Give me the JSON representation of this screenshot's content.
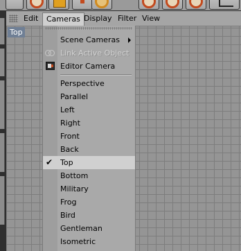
{
  "menubar": {
    "items": [
      {
        "label": "Edit"
      },
      {
        "label": "Cameras"
      },
      {
        "label": "Display"
      },
      {
        "label": "Filter"
      },
      {
        "label": "View"
      }
    ]
  },
  "viewport": {
    "view_label": "Top"
  },
  "cameras_menu": {
    "items": [
      {
        "label": "Scene Cameras",
        "has_submenu": true
      },
      {
        "label": "Link Active Object",
        "enabled": false,
        "icon": "link-icon"
      },
      {
        "label": "Editor Camera",
        "icon": "camera-icon"
      },
      {
        "label": "Perspective"
      },
      {
        "label": "Parallel"
      },
      {
        "label": "Left"
      },
      {
        "label": "Right"
      },
      {
        "label": "Front"
      },
      {
        "label": "Back"
      },
      {
        "label": "Top",
        "checked": true,
        "check_glyph": "✔"
      },
      {
        "label": "Bottom"
      },
      {
        "label": "Military"
      },
      {
        "label": "Frog"
      },
      {
        "label": "Bird"
      },
      {
        "label": "Gentleman"
      },
      {
        "label": "Isometric"
      }
    ]
  },
  "colors": {
    "viewport_bg": "#959595",
    "grid_line": "#7d7d7d",
    "menu_bg": "#a9a9a9",
    "view_label_bg": "#6f7f95",
    "checked_row_bg": "#d0d0d0"
  }
}
